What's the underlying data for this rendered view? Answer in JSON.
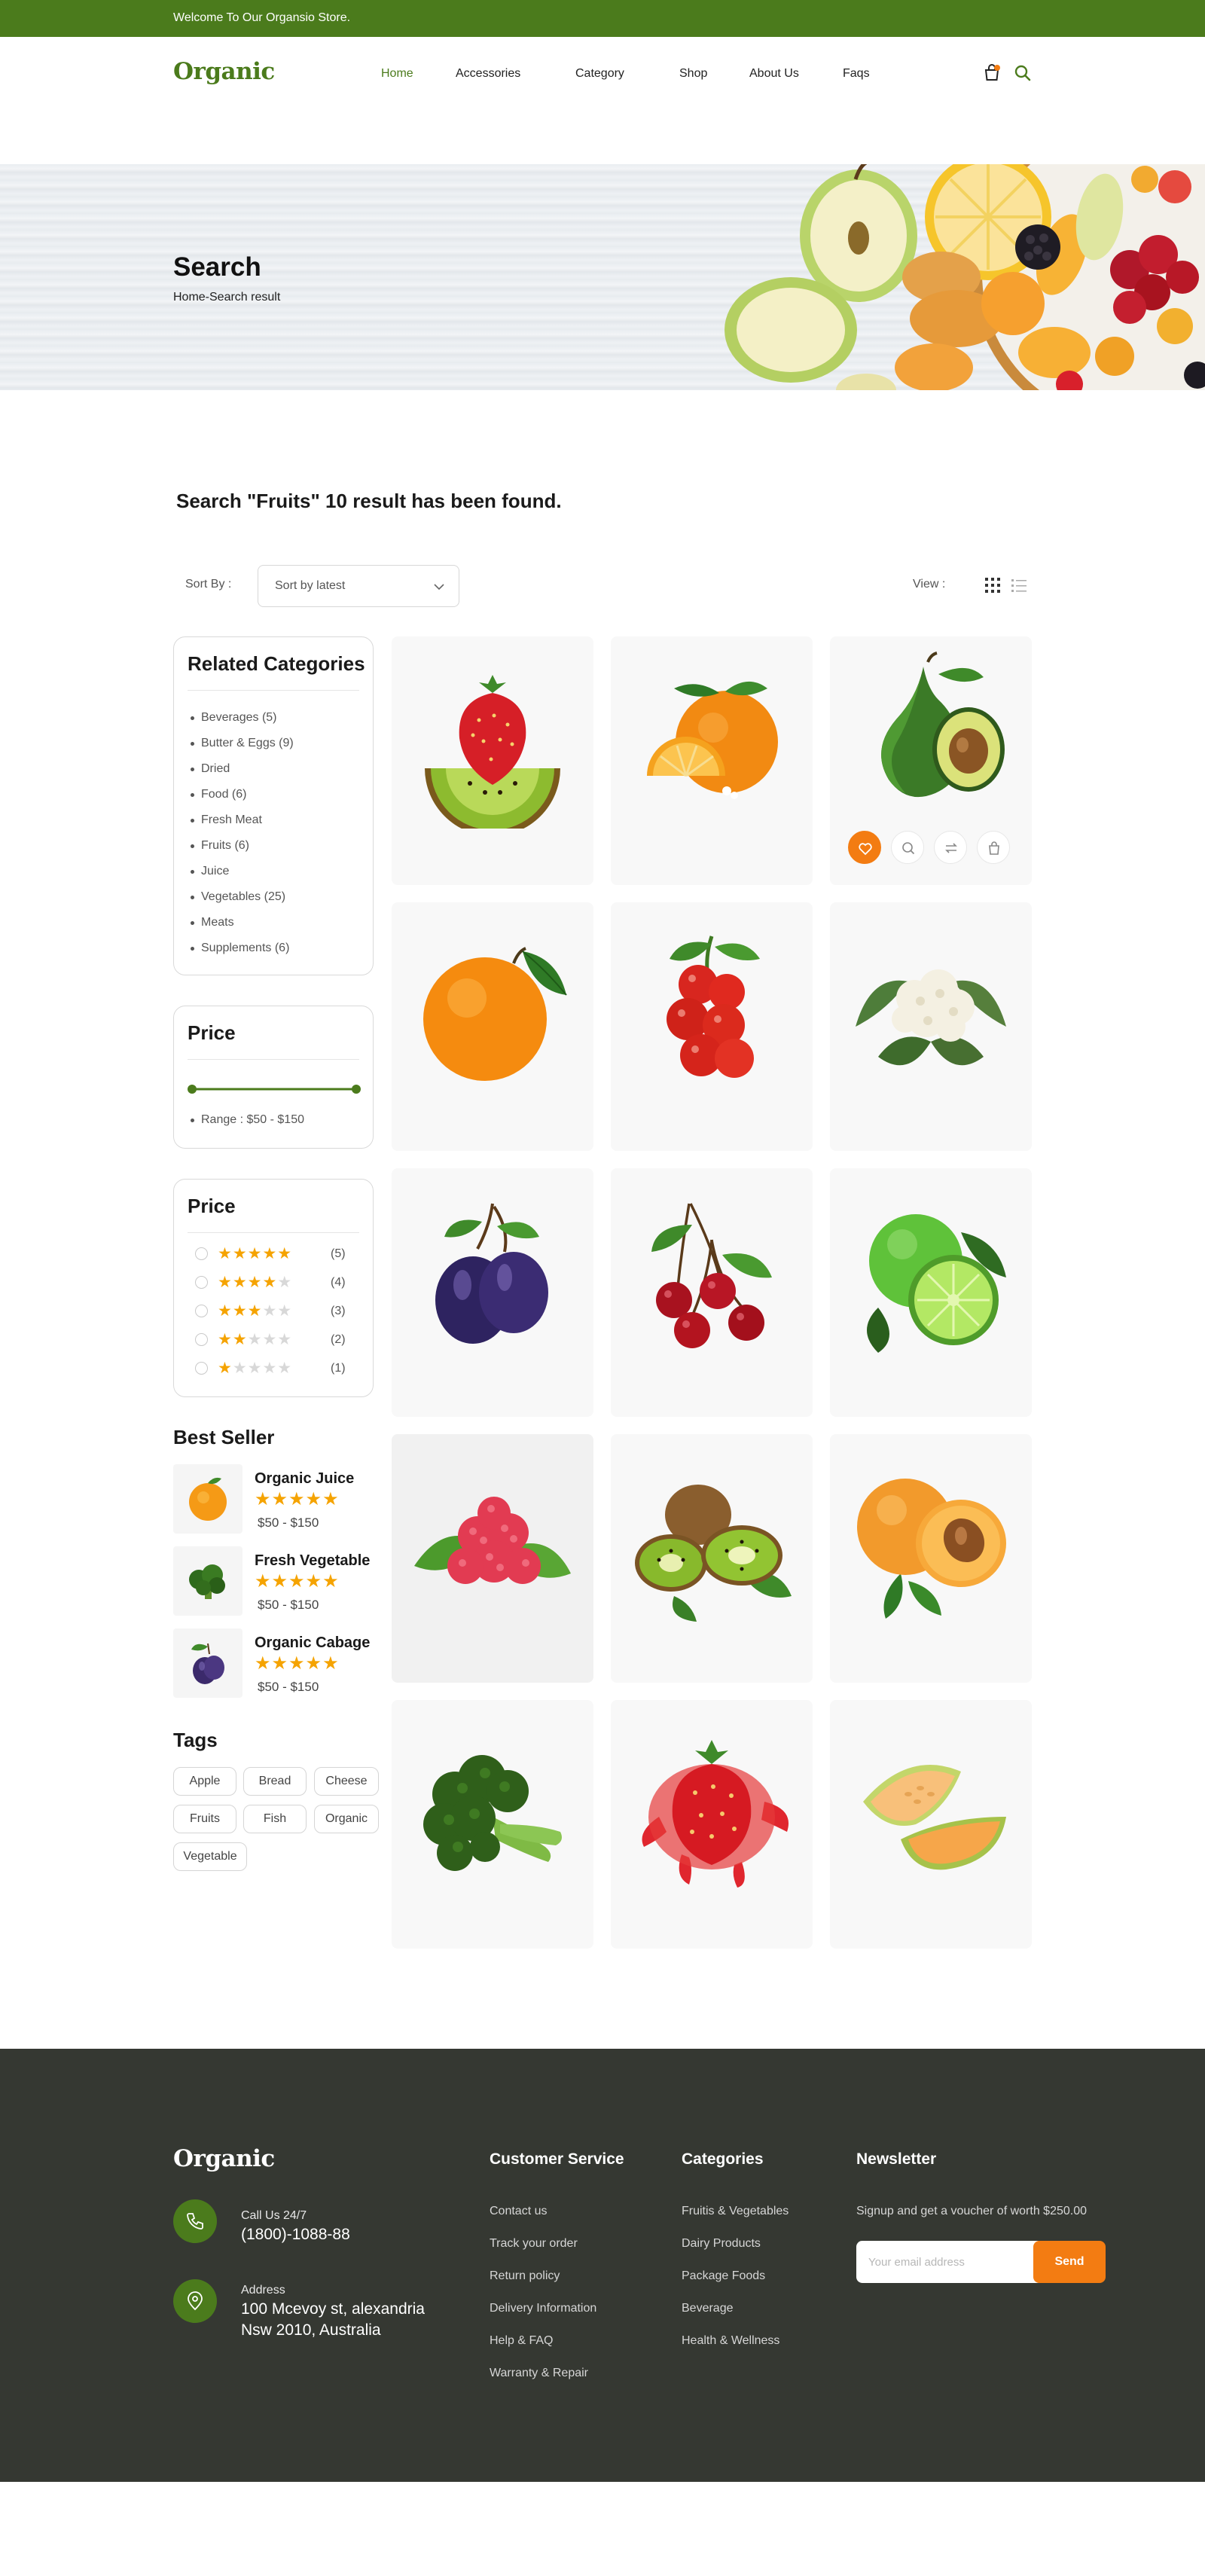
{
  "topbar": {
    "welcome": "Welcome To Our Organsio Store."
  },
  "header": {
    "logo": "Organic",
    "nav": [
      "Home",
      "Accessories",
      "Category",
      "Shop",
      "About Us",
      "Faqs"
    ],
    "active_nav": "Home",
    "icons": [
      "shopping-bag-icon",
      "search-icon"
    ]
  },
  "banner": {
    "title": "Search",
    "breadcrumb": "Home-Search result"
  },
  "results": {
    "heading": "Search  \"Fruits\" 10 result has been found."
  },
  "sort": {
    "label": "Sort By :",
    "selected": "Sort by latest",
    "view_label": "View :",
    "views": [
      "grid-view-icon",
      "list-view-icon"
    ]
  },
  "sidebar": {
    "categories": {
      "title": "Related Categories",
      "items": [
        "Beverages (5)",
        "Butter & Eggs (9)",
        "Dried",
        "Food (6)",
        "Fresh Meat",
        "Fruits (6)",
        "Juice",
        "Vegetables (25)",
        "Meats",
        "Supplements (6)"
      ]
    },
    "price": {
      "title": "Price",
      "range": "Range : $50 - $150"
    },
    "rating": {
      "title": "Price",
      "rows": [
        {
          "stars": 5,
          "count": "(5)"
        },
        {
          "stars": 4,
          "count": "(4)"
        },
        {
          "stars": 3,
          "count": "(3)"
        },
        {
          "stars": 2,
          "count": "(2)"
        },
        {
          "stars": 1,
          "count": "(1)"
        }
      ]
    },
    "best_seller": {
      "title": "Best Seller",
      "items": [
        {
          "name": "Organic Juice",
          "price": "$50 - $150",
          "stars": 5,
          "image": "orange"
        },
        {
          "name": "Fresh Vegetable",
          "price": "$50 - $150",
          "stars": 5,
          "image": "broccoli"
        },
        {
          "name": "Organic Cabage",
          "price": "$50 - $150",
          "stars": 5,
          "image": "plum"
        }
      ]
    },
    "tags": {
      "title": "Tags",
      "items": [
        "Apple",
        "Bread",
        "Cheese",
        "Fruits",
        "Fish",
        "Organic",
        "Vegetable"
      ]
    }
  },
  "products": [
    {
      "image": "strawberry-kiwi"
    },
    {
      "image": "orange-slices"
    },
    {
      "image": "avocado",
      "hover_actions": [
        "heart-icon",
        "zoom-icon",
        "compare-icon",
        "cart-icon"
      ]
    },
    {
      "image": "orange"
    },
    {
      "image": "tomatoes"
    },
    {
      "image": "cauliflower"
    },
    {
      "image": "plums"
    },
    {
      "image": "cherries"
    },
    {
      "image": "limes"
    },
    {
      "image": "raspberries"
    },
    {
      "image": "kiwis"
    },
    {
      "image": "apricots"
    },
    {
      "image": "broccoli"
    },
    {
      "image": "strawberry-splash"
    },
    {
      "image": "melon"
    }
  ],
  "footer": {
    "logo": "Organic",
    "call_label": "Call Us 24/7",
    "phone": "(1800)-1088-88",
    "address_label": "Address",
    "address_line1": "100 Mcevoy st, alexandria",
    "address_line2": "Nsw 2010, Australia",
    "customer_service": {
      "title": "Customer Service",
      "links": [
        "Contact us",
        "Track your order",
        "Return policy",
        "Delivery Information",
        "Help & FAQ",
        "Warranty & Repair"
      ]
    },
    "categories": {
      "title": "Categories",
      "links": [
        "Fruitis & Vegetables",
        "Dairy Products",
        "Package Foods",
        "Beverage",
        "Health & Wellness"
      ]
    },
    "newsletter": {
      "title": "Newsletter",
      "text": "Signup and get a voucher of worth $250.00",
      "placeholder": "Your email address",
      "button": "Send"
    }
  },
  "colors": {
    "brand_green": "#4b7b1c",
    "accent_orange": "#f37c12",
    "footer_bg": "#353832",
    "star": "#f5a300"
  }
}
